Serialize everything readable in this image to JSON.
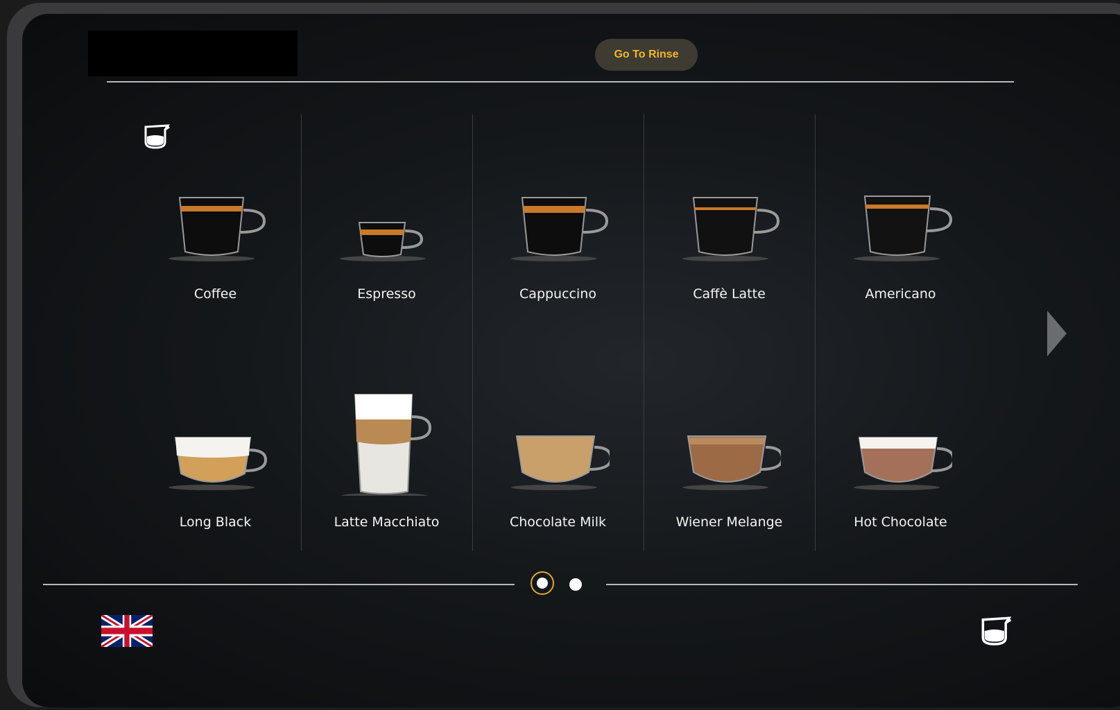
{
  "header": {
    "rinse_label": "Go To Rinse"
  },
  "colors": {
    "accent": "#f2b824",
    "button_bg": "#3e3b33",
    "active_dot_ring": "#e0a92a"
  },
  "drinks": [
    {
      "label": "Coffee"
    },
    {
      "label": "Espresso"
    },
    {
      "label": "Cappuccino"
    },
    {
      "label": "Caffè Latte"
    },
    {
      "label": "Americano"
    },
    {
      "label": "Long Black"
    },
    {
      "label": "Latte Macchiato"
    },
    {
      "label": "Chocolate Milk"
    },
    {
      "label": "Wiener Melange"
    },
    {
      "label": "Hot Chocolate"
    }
  ],
  "pagination": {
    "pages": 2,
    "current": 1
  },
  "icons": {
    "top_left": "coffee-pot-icon",
    "next": "chevron-right-icon",
    "language": "uk-flag-icon",
    "bottom_right": "coffee-pot-icon"
  }
}
